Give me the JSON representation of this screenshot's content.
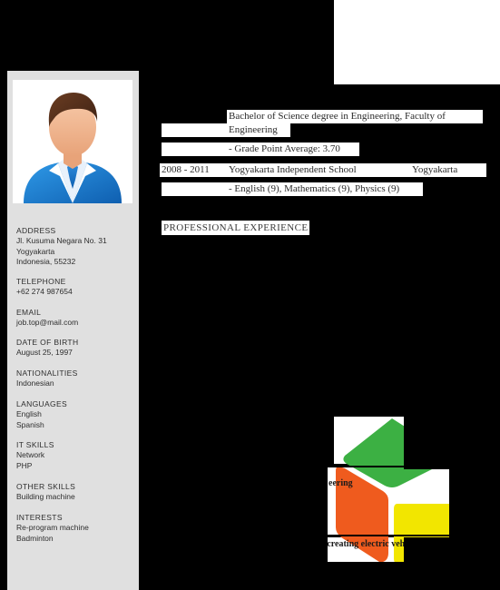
{
  "document": {
    "type": "curriculum-vitae",
    "render_state": "partially-rendered"
  },
  "colors": {
    "page_background": "#000000",
    "sidebar_background": "#e0e0e0",
    "panel_background": "#ffffff",
    "text_primary": "#2b2b2b",
    "logo_green": "#3cb043",
    "logo_orange": "#ef5b1e",
    "logo_yellow": "#f2e600",
    "suit_blue": "#1f7fd4",
    "skin": "#f0b08a",
    "hair": "#5c3320"
  },
  "sidebar": {
    "avatar": {
      "icon": "person-avatar-icon",
      "alt": "Profile photo placeholder"
    },
    "blocks": [
      {
        "heading": "ADDRESS",
        "lines": [
          "Jl. Kusuma Negara No. 31",
          "Yogyakarta",
          "Indonesia, 55232"
        ]
      },
      {
        "heading": "TELEPHONE",
        "lines": [
          "+62 274 987654"
        ]
      },
      {
        "heading": "EMAIL",
        "lines": [
          "job.top@mail.com"
        ]
      },
      {
        "heading": "DATE OF BIRTH",
        "lines": [
          "August 25, 1997"
        ]
      },
      {
        "heading": "NATIONALITIES",
        "lines": [
          "Indonesian"
        ]
      },
      {
        "heading": "LANGUAGES",
        "lines": [
          "English",
          "Spanish"
        ]
      },
      {
        "heading": "IT SKILLS",
        "lines": [
          "Network",
          "PHP"
        ]
      },
      {
        "heading": "OTHER SKILLS",
        "lines": [
          "Building machine"
        ]
      },
      {
        "heading": "INTERESTS",
        "lines": [
          "Re-program machine",
          "Badminton"
        ]
      }
    ]
  },
  "education": {
    "rows": [
      {
        "period": "",
        "text": "Bachelor of Science degree in Engineering, Faculty of"
      },
      {
        "period": "",
        "text": "Engineering"
      },
      {
        "period": "",
        "text": "- Grade Point Average: 3.70"
      },
      {
        "period": "2008 - 2011",
        "text": "Yogyakarta Independent School",
        "location": "Yogyakarta"
      },
      {
        "period": "",
        "text": "- English (9), Mathematics (9), Physics (9)"
      }
    ]
  },
  "sections": {
    "professional_experience": "PROFESSIONAL EXPERIENCE"
  },
  "figure": {
    "name": "isometric-cube-logo",
    "shapes": [
      "green-top-face",
      "orange-left-face",
      "yellow-right-face"
    ],
    "text_fragments": [
      "eering",
      "y of creating electric vehicl"
    ]
  }
}
